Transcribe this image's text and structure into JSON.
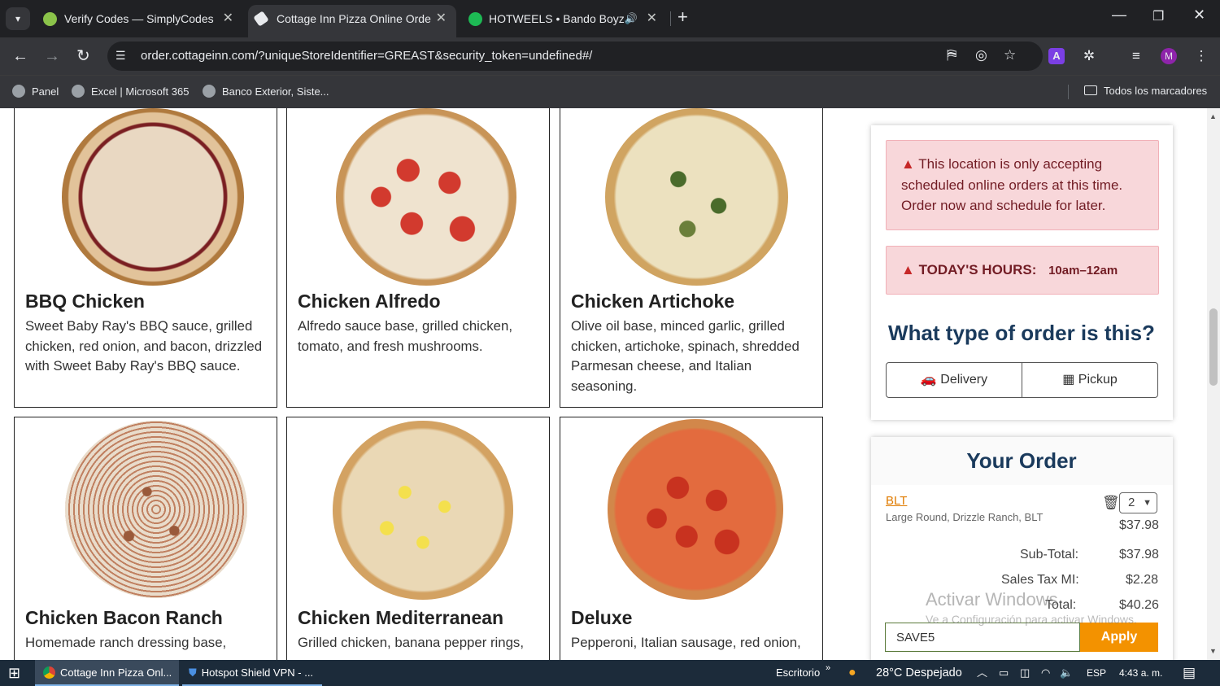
{
  "browser": {
    "tabs": [
      {
        "title": "Verify Codes — SimplyCodes",
        "active": false
      },
      {
        "title": "Cottage Inn Pizza Online Order",
        "active": true
      },
      {
        "title": "HOTWEELS • Bando Boyz, Y",
        "active": false
      }
    ],
    "url": "order.cottageinn.com/?uniqueStoreIdentifier=GREAST&security_token=undefined#/",
    "profile_initial": "M",
    "bookmarks": [
      "Panel",
      "Excel | Microsoft 365",
      "Banco Exterior, Siste..."
    ],
    "all_bookmarks": "Todos los marcadores"
  },
  "menu": [
    {
      "name": "BBQ Chicken",
      "desc": "Sweet Baby Ray's BBQ sauce, grilled chicken, red onion, and bacon, drizzled with Sweet Baby Ray's BBQ sauce."
    },
    {
      "name": "Chicken Alfredo",
      "desc": "Alfredo sauce base, grilled chicken, tomato, and fresh mushrooms."
    },
    {
      "name": "Chicken Artichoke",
      "desc": "Olive oil base, minced garlic, grilled chicken, artichoke, spinach, shredded Parmesan cheese, and Italian seasoning."
    },
    {
      "name": "Chicken Bacon Ranch",
      "desc": "Homemade ranch dressing base,"
    },
    {
      "name": "Chicken Mediterranean",
      "desc": "Grilled chicken, banana pepper rings,"
    },
    {
      "name": "Deluxe",
      "desc": "Pepperoni, Italian sausage, red onion,"
    }
  ],
  "sidebar": {
    "alert_schedule": "This location is only accepting scheduled online orders at this time. Order now and schedule for later.",
    "hours_label": "TODAY'S HOURS:",
    "hours_value": "10am–12am",
    "order_type_title": "What type of order is this?",
    "delivery_label": "Delivery",
    "pickup_label": "Pickup"
  },
  "order": {
    "title": "Your Order",
    "item_name": "BLT",
    "item_desc": "Large Round, Drizzle Ranch, BLT",
    "qty": "2",
    "item_price": "$37.98",
    "subtotal_label": "Sub-Total:",
    "subtotal": "$37.98",
    "tax_label": "Sales Tax MI:",
    "tax": "$2.28",
    "total_label": "Total:",
    "total": "$40.26",
    "promo_value": "SAVE5",
    "apply_label": "Apply"
  },
  "watermark": {
    "line1": "Activar Windows",
    "line2": "Ve a Configuración para activar Windows."
  },
  "taskbar": {
    "app1": "Cottage Inn Pizza Onl...",
    "app2": "Hotspot Shield VPN - ...",
    "desktop": "Escritorio",
    "weather": "28°C  Despejado",
    "lang": "ESP",
    "time": "4:43 a. m."
  }
}
